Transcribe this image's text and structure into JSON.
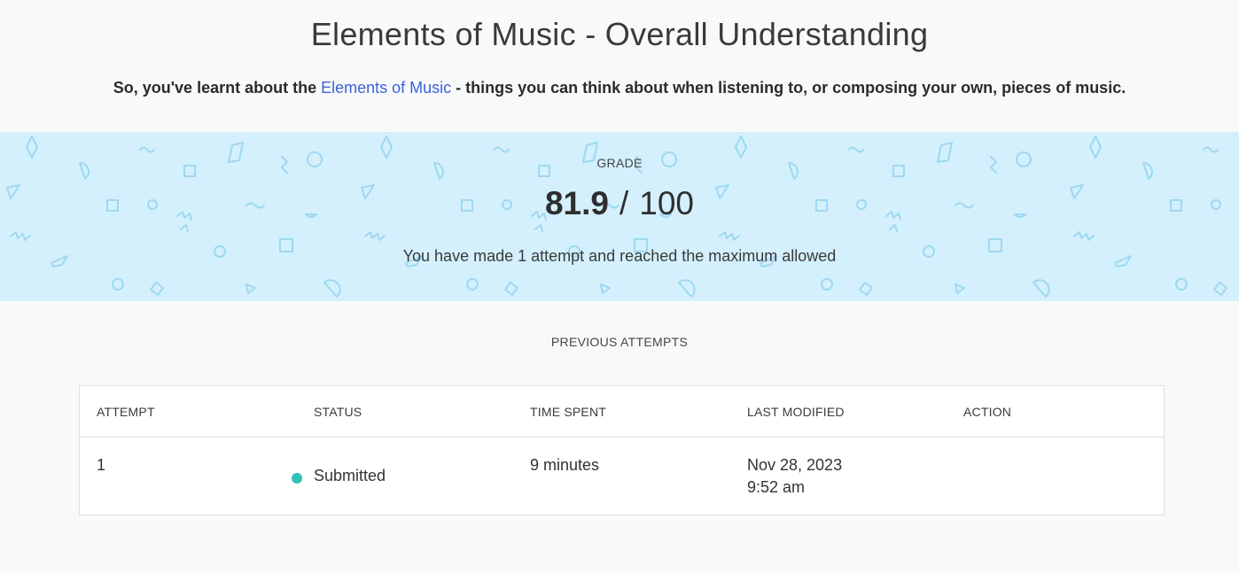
{
  "quiz": {
    "title": "Elements of Music - Overall Understanding",
    "intro_prefix": "So, you've learnt about the ",
    "intro_link": "Elements of Music",
    "intro_suffix": " - things you can think about when listening to, or composing your own, pieces of music."
  },
  "grade": {
    "label": "GRADE",
    "score": "81.9",
    "separator": "/",
    "max": "100",
    "attempt_message": "You have made 1 attempt and reached the maximum allowed",
    "band_color": "#d3f0fc"
  },
  "previous_attempts": {
    "heading": "PREVIOUS ATTEMPTS",
    "columns": [
      "ATTEMPT",
      "STATUS",
      "TIME SPENT",
      "LAST MODIFIED",
      "ACTION"
    ],
    "rows": [
      {
        "attempt": "1",
        "status": "Submitted",
        "status_color": "#2ec4b6",
        "time_spent": "9 minutes",
        "last_modified_date": "Nov 28, 2023",
        "last_modified_time": "9:52 am",
        "action": ""
      }
    ]
  }
}
